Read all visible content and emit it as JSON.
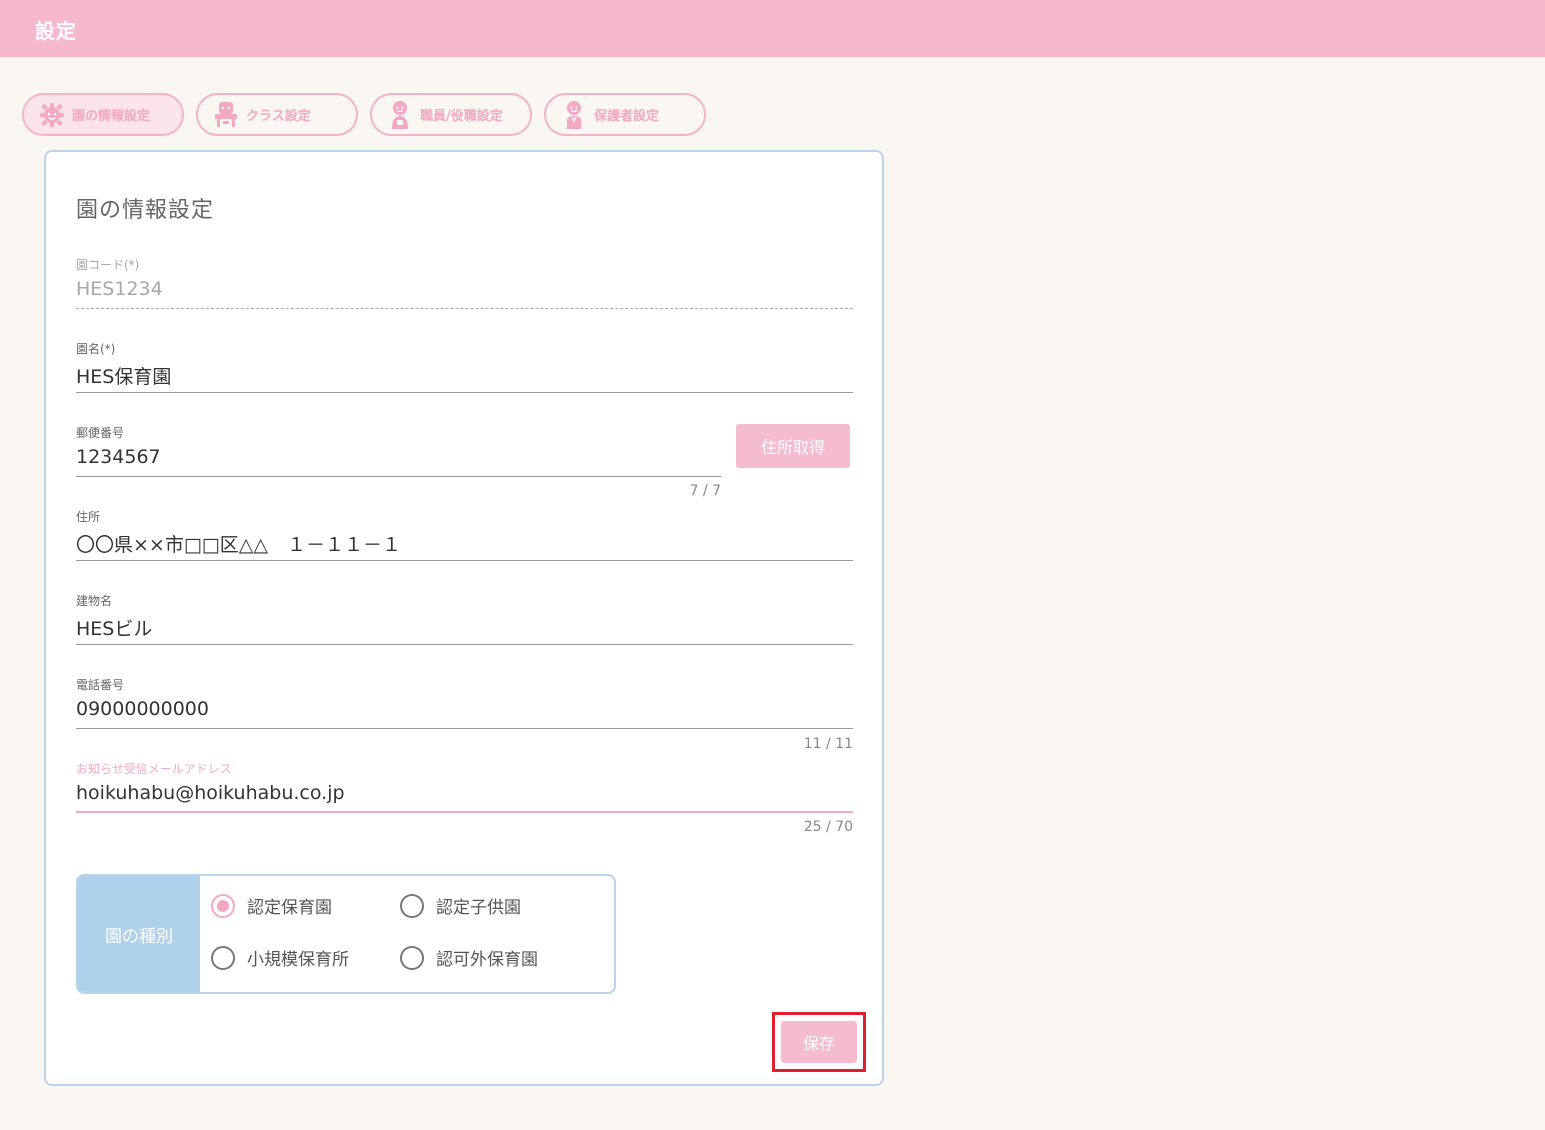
{
  "header": {
    "title": "設定"
  },
  "tabs": [
    {
      "label": "園の情報設定",
      "icon": "gear-icon"
    },
    {
      "label": "クラス設定",
      "icon": "teacher-desk-icon"
    },
    {
      "label": "職員/役職設定",
      "icon": "staff-person-icon"
    },
    {
      "label": "保護者設定",
      "icon": "guardian-person-icon"
    }
  ],
  "form": {
    "title": "園の情報設定",
    "code": {
      "label": "園コード(*)",
      "value": "HES1234"
    },
    "name": {
      "label": "園名(*)",
      "value": "HES保育園"
    },
    "postal": {
      "label": "郵便番号",
      "value": "1234567",
      "counter": "7 / 7"
    },
    "address_button": "住所取得",
    "address": {
      "label": "住所",
      "value": "〇〇県××市□□区△△　１－１１－１"
    },
    "building": {
      "label": "建物名",
      "value": "HESビル"
    },
    "phone": {
      "label": "電話番号",
      "value": "09000000000",
      "counter": "11 / 11"
    },
    "email": {
      "label": "お知らせ受信メールアドレス",
      "value": "hoikuhabu@hoikuhabu.co.jp",
      "counter": "25 / 70"
    },
    "type": {
      "label": "園の種別",
      "options": [
        {
          "label": "認定保育園",
          "checked": true
        },
        {
          "label": "認定子供園",
          "checked": false
        },
        {
          "label": "小規模保育所",
          "checked": false
        },
        {
          "label": "認可外保育園",
          "checked": false
        }
      ]
    },
    "save_label": "保存"
  },
  "colors": {
    "header_pink": "#f5b8cd",
    "accent_pink": "#f3a9c1",
    "accent_blue": "#b0d1ea",
    "highlight_red": "#e01e2e",
    "background": "#faf6f2"
  }
}
